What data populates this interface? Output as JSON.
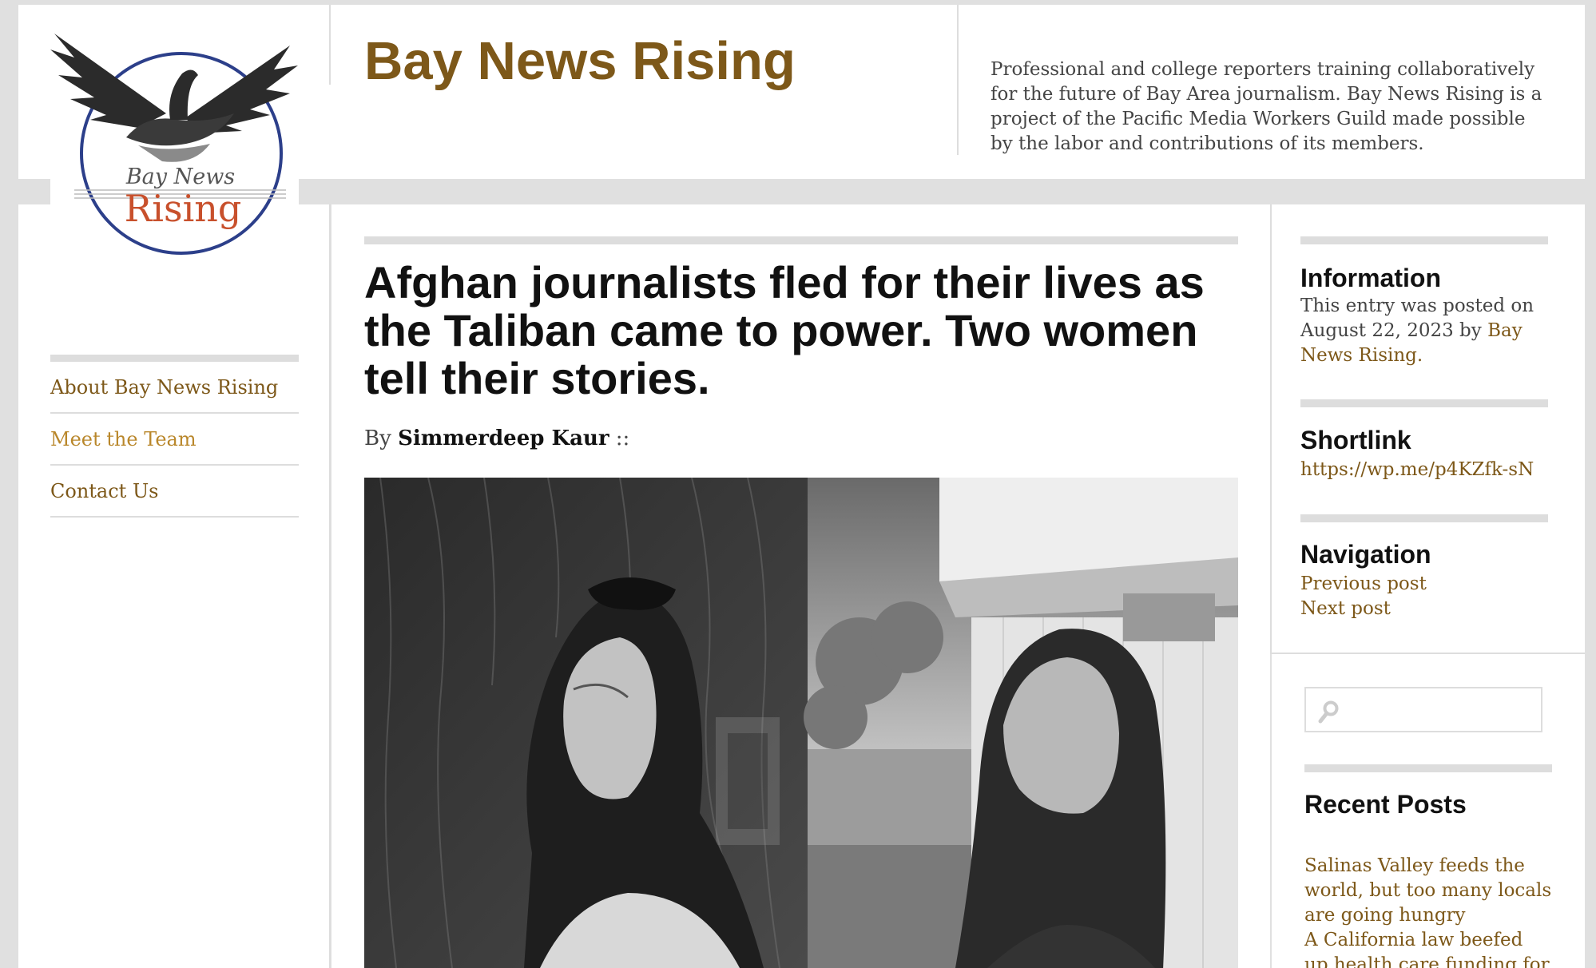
{
  "site": {
    "title": "Bay News Rising",
    "description": "Professional and college reporters training collaboratively for the future of Bay Area journalism. Bay News Rising is a project of the Pacific Media Workers Guild made possible by the labor and contributions of its members.",
    "logo_text_top": "Bay News",
    "logo_text_bottom": "Rising"
  },
  "nav": {
    "items": [
      {
        "label": "About Bay News Rising"
      },
      {
        "label": "Meet the Team"
      },
      {
        "label": "Contact Us"
      }
    ]
  },
  "article": {
    "title": "Afghan journalists fled for their lives as the Taliban came to power. Two women tell their stories.",
    "by_prefix": "By",
    "author": "Simmerdeep Kaur",
    "by_suffix": "::"
  },
  "sidebar": {
    "information": {
      "title": "Information",
      "text": "This entry was posted on August 22, 2023 by",
      "author_link": "Bay News Rising",
      "period": "."
    },
    "shortlink": {
      "title": "Shortlink",
      "url": "https://wp.me/p4KZfk-sN"
    },
    "navigation": {
      "title": "Navigation",
      "previous": "Previous post",
      "next": "Next post"
    },
    "search": {
      "placeholder": ""
    },
    "recent_posts": {
      "title": "Recent Posts",
      "items": [
        "Salinas Valley feeds the world, but too many locals are going hungry",
        "A California law beefed up health care funding for"
      ]
    }
  },
  "colors": {
    "accent": "#7d5819",
    "accent_light": "#b9872b",
    "logo_ring": "#2c3f8a",
    "logo_red": "#c8502c"
  },
  "icons": [
    "search-icon",
    "logo-birds"
  ]
}
